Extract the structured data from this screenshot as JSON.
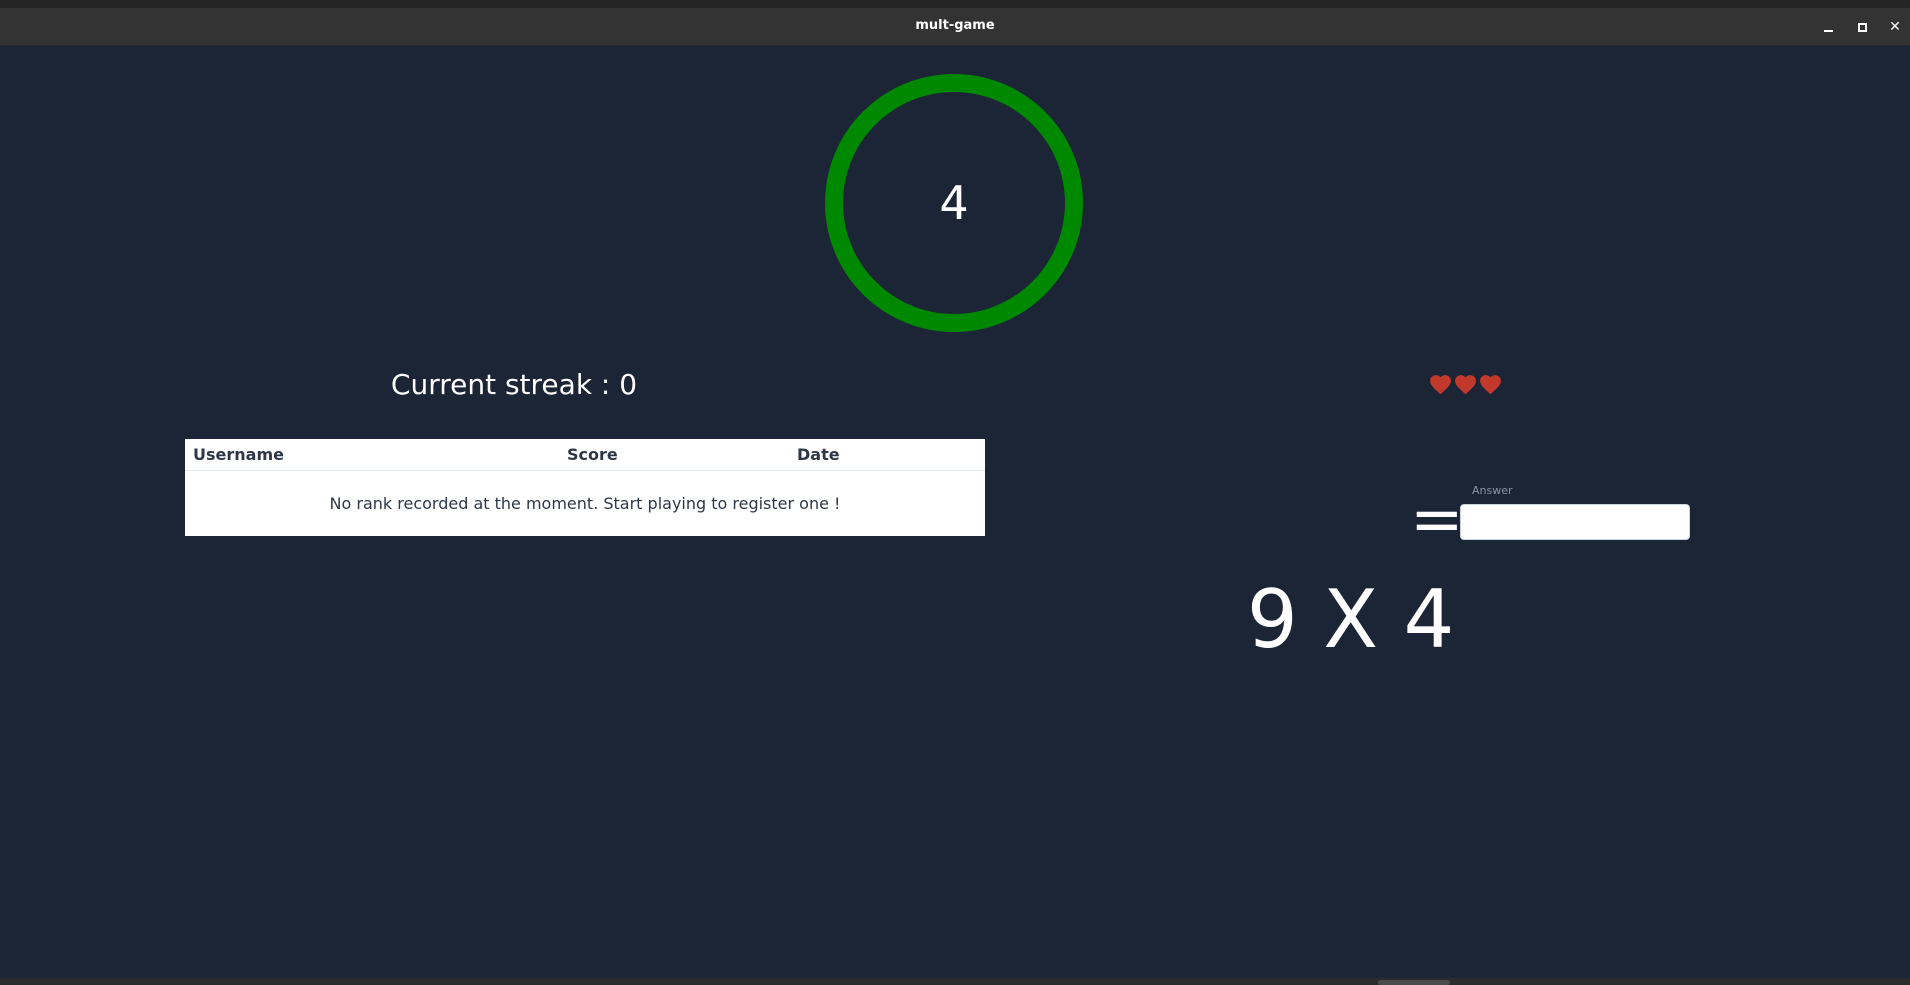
{
  "window": {
    "title": "mult-game",
    "minimize_icon": "minimize-icon",
    "maximize_icon": "maximize-icon",
    "close_icon": "close-icon",
    "close_glyph": "✕"
  },
  "timer": {
    "value": "4",
    "ring_color": "#008800",
    "fraction_remaining": 1.0
  },
  "streak": {
    "label": "Current streak : 0"
  },
  "lives": {
    "count": 3,
    "icon": "heart-icon",
    "color": "#c0392b"
  },
  "leaderboard": {
    "columns": [
      "Username",
      "Score",
      "Date"
    ],
    "empty_message": "No rank recorded at the moment. Start playing to register one !"
  },
  "question": {
    "operand_a": "9",
    "operator": "X",
    "operand_b": "4",
    "equals": "=",
    "answer_label": "Answer",
    "answer_value": ""
  },
  "colors": {
    "background": "#1c2536",
    "titlebar": "#333333"
  }
}
